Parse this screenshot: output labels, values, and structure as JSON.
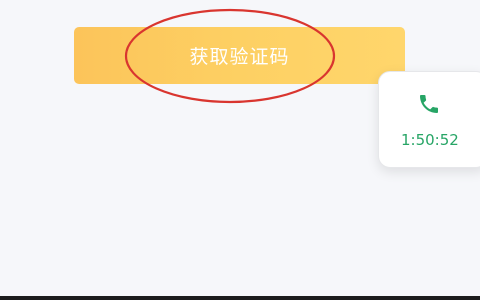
{
  "button": {
    "label": "获取验证码"
  },
  "call_widget": {
    "timer": "1:50:52",
    "icon": "phone-icon"
  },
  "colors": {
    "button_gradient_start": "#fcc45a",
    "button_gradient_end": "#ffd66c",
    "annotation_ellipse": "#d9352f",
    "call_green": "#27a566",
    "background": "#f6f7fa"
  }
}
